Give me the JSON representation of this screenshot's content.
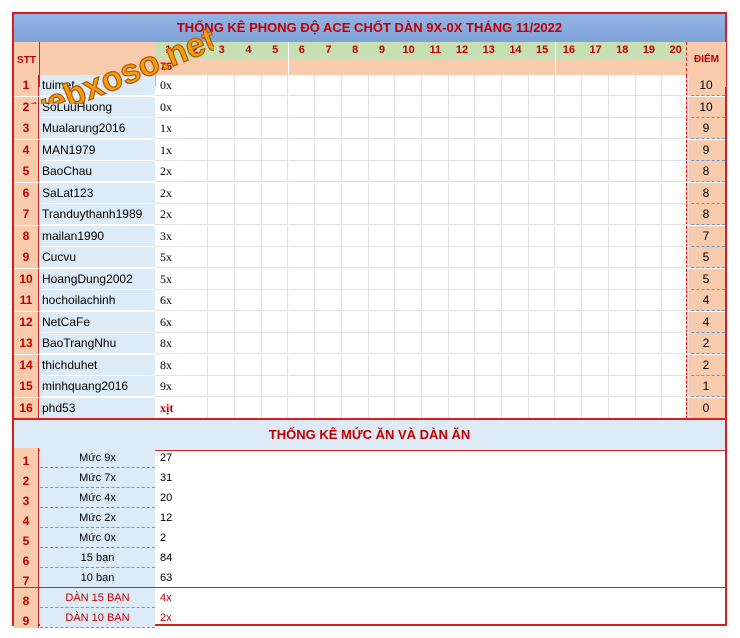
{
  "title": "THỐNG KÊ PHONG ĐỘ ACE CHỐT DÀN 9X-0X THÁNG 11/2022",
  "watermark": "webxoso.net",
  "headers": {
    "stt": "STT",
    "diem": "ĐIỂM",
    "days": [
      "1",
      "2",
      "3",
      "4",
      "5",
      "6",
      "7",
      "8",
      "9",
      "10",
      "11",
      "12",
      "13",
      "14",
      "15",
      "16",
      "17",
      "18",
      "19",
      "20"
    ],
    "day1_total": "76"
  },
  "players": [
    {
      "stt": "1",
      "name": "tuimet",
      "val": "0x",
      "diem": "10"
    },
    {
      "stt": "2",
      "name": "SoLuuHuong",
      "val": "0x",
      "diem": "10"
    },
    {
      "stt": "3",
      "name": "Mualarung2016",
      "val": "1x",
      "diem": "9"
    },
    {
      "stt": "4",
      "name": "MAN1979",
      "val": "1x",
      "diem": "9"
    },
    {
      "stt": "5",
      "name": "BaoChau",
      "val": "2x",
      "diem": "8"
    },
    {
      "stt": "6",
      "name": "SaLat123",
      "val": "2x",
      "diem": "8"
    },
    {
      "stt": "7",
      "name": "Tranduythanh1989",
      "val": "2x",
      "diem": "8"
    },
    {
      "stt": "8",
      "name": "mailan1990",
      "val": "3x",
      "diem": "7"
    },
    {
      "stt": "9",
      "name": "Cucvu",
      "val": "5x",
      "diem": "5"
    },
    {
      "stt": "10",
      "name": "HoangDung2002",
      "val": "5x",
      "diem": "5"
    },
    {
      "stt": "11",
      "name": "hochoilachinh",
      "val": "6x",
      "diem": "4"
    },
    {
      "stt": "12",
      "name": "NetCaFe",
      "val": "6x",
      "diem": "4"
    },
    {
      "stt": "13",
      "name": "BaoTrangNhu",
      "val": "8x",
      "diem": "2"
    },
    {
      "stt": "14",
      "name": "thichduhet",
      "val": "8x",
      "diem": "2"
    },
    {
      "stt": "15",
      "name": "minhquang2016",
      "val": "9x",
      "diem": "1"
    },
    {
      "stt": "16",
      "name": "phd53",
      "val": "xịt",
      "diem": "0"
    }
  ],
  "summary_title": "THỐNG KÊ MỨC ĂN VÀ DÀN ĂN",
  "summary": [
    {
      "stt": "1",
      "label": "Mức 9x",
      "val": "27"
    },
    {
      "stt": "2",
      "label": "Mức 7x",
      "val": "31"
    },
    {
      "stt": "3",
      "label": "Mức 4x",
      "val": "20"
    },
    {
      "stt": "4",
      "label": "Mức 2x",
      "val": "12"
    },
    {
      "stt": "5",
      "label": "Mức 0x",
      "val": "2"
    },
    {
      "stt": "6",
      "label": "15 bạn",
      "val": "84"
    },
    {
      "stt": "7",
      "label": "10 bạn",
      "val": "63"
    }
  ],
  "dan": [
    {
      "stt": "8",
      "label": "DÀN 15 BẠN",
      "val": "4x"
    },
    {
      "stt": "9",
      "label": "DÀN 10 BẠN",
      "val": "2x"
    }
  ]
}
